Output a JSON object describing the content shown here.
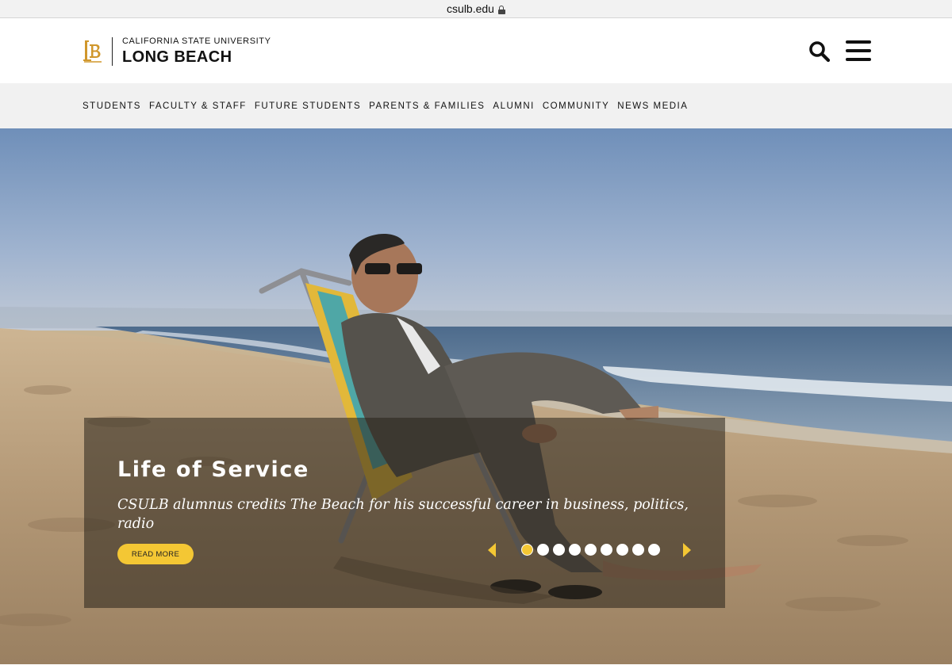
{
  "browser": {
    "url": "csulb.edu",
    "secure_icon": "lock-icon"
  },
  "header": {
    "logo_icon": "lb-monogram",
    "university_line1": "CALIFORNIA STATE UNIVERSITY",
    "university_line2": "LONG BEACH",
    "search_icon": "search-icon",
    "menu_icon": "hamburger-menu-icon"
  },
  "nav": {
    "items": [
      {
        "label": "STUDENTS"
      },
      {
        "label": "FACULTY & STAFF"
      },
      {
        "label": "FUTURE STUDENTS"
      },
      {
        "label": "PARENTS & FAMILIES"
      },
      {
        "label": "ALUMNI"
      },
      {
        "label": "COMMUNITY"
      },
      {
        "label": "NEWS MEDIA"
      }
    ]
  },
  "hero": {
    "title": "Life of Service",
    "subtitle": "CSULB alumnus credits The Beach for his successful career in business, politics, radio",
    "read_more_label": "READ MORE",
    "slide_count": 9,
    "active_slide": 1,
    "prev_icon": "caret-left-icon",
    "next_icon": "caret-right-icon"
  },
  "colors": {
    "accent_gold": "#f4c734",
    "logo_gold": "#d0972c",
    "nav_background": "#f1f1f1",
    "text_dark": "#111111"
  }
}
